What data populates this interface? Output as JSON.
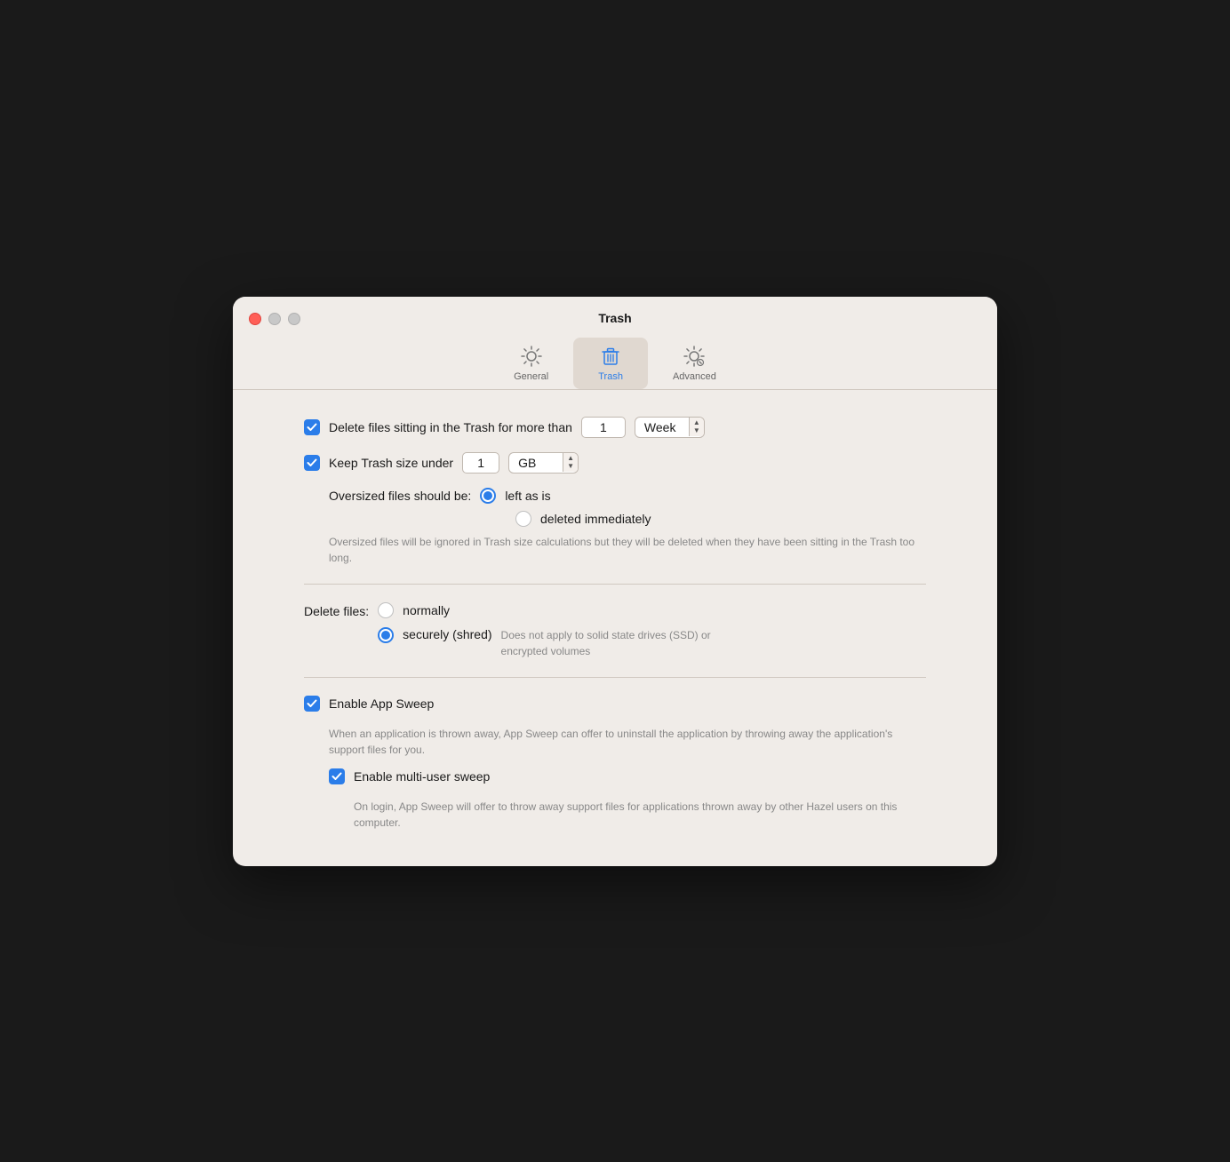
{
  "window": {
    "title": "Trash"
  },
  "trafficLights": {
    "close": "close",
    "minimize": "minimize",
    "maximize": "maximize"
  },
  "toolbar": {
    "tabs": [
      {
        "id": "general",
        "label": "General",
        "active": false
      },
      {
        "id": "trash",
        "label": "Trash",
        "active": true
      },
      {
        "id": "advanced",
        "label": "Advanced",
        "active": false
      }
    ]
  },
  "settings": {
    "deleteFilesRow": {
      "checked": true,
      "label": "Delete files sitting in the Trash for more than",
      "value": "1",
      "unit": "Week"
    },
    "keepTrashRow": {
      "checked": true,
      "label": "Keep Trash size under",
      "value": "1",
      "unit": "GB"
    },
    "oversizedLabel": "Oversized files should be:",
    "oversizedOptions": [
      {
        "label": "left as is",
        "selected": true
      },
      {
        "label": "deleted immediately",
        "selected": false
      }
    ],
    "oversizedHint": "Oversized files will be ignored in Trash size calculations but they will be deleted when they have been sitting in the Trash too long.",
    "deleteFilesLabel": "Delete files:",
    "deleteOptions": [
      {
        "label": "normally",
        "selected": false
      },
      {
        "label": "securely (shred)",
        "selected": true
      }
    ],
    "securelyNote": "Does not apply to solid state drives (SSD) or encrypted volumes",
    "enableAppSweep": {
      "checked": true,
      "label": "Enable App Sweep",
      "hint": "When an application is thrown away, App Sweep can offer to uninstall the application by throwing away the application's support files for you."
    },
    "enableMultiUserSweep": {
      "checked": true,
      "label": "Enable multi-user sweep",
      "hint": "On login, App Sweep will offer to throw away support files for applications thrown away by other Hazel users on this computer."
    }
  }
}
